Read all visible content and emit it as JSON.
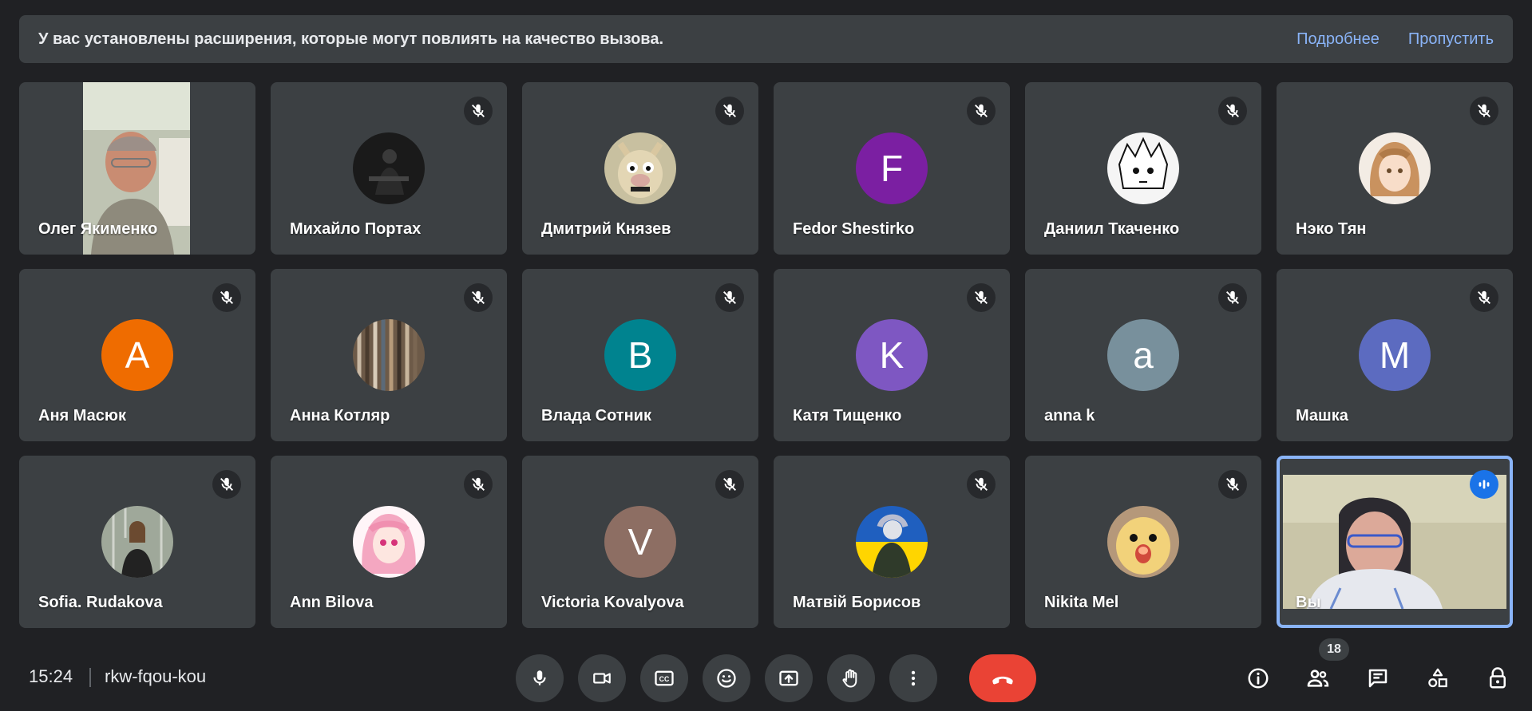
{
  "banner": {
    "message": "У вас установлены расширения, которые могут повлиять на качество вызова.",
    "more_link": "Подробнее",
    "skip_link": "Пропустить"
  },
  "participants": [
    {
      "name": "Олег Якименко",
      "kind": "video",
      "muted": false
    },
    {
      "name": "Михайло Портах",
      "kind": "photo",
      "muted": true
    },
    {
      "name": "Дмитрий Князев",
      "kind": "photo",
      "muted": true
    },
    {
      "name": "Fedor Shestirko",
      "kind": "letter",
      "letter": "F",
      "color": "#7b1fa2",
      "muted": true
    },
    {
      "name": "Даниил Ткаченко",
      "kind": "photo",
      "muted": true
    },
    {
      "name": "Нэко Тян",
      "kind": "photo",
      "muted": true
    },
    {
      "name": "Аня Масюк",
      "kind": "letter",
      "letter": "A",
      "color": "#ef6c00",
      "muted": true
    },
    {
      "name": "Анна Котляр",
      "kind": "photo",
      "muted": true
    },
    {
      "name": "Влада Сотник",
      "kind": "letter",
      "letter": "B",
      "color": "#00838f",
      "muted": true
    },
    {
      "name": "Катя Тищенко",
      "kind": "letter",
      "letter": "K",
      "color": "#7e57c2",
      "muted": true
    },
    {
      "name": "anna k",
      "kind": "letter",
      "letter": "a",
      "color": "#78909c",
      "muted": true
    },
    {
      "name": "Машка",
      "kind": "letter",
      "letter": "M",
      "color": "#5c6bc0",
      "muted": true
    },
    {
      "name": "Sofia. Rudakova",
      "kind": "photo",
      "muted": true
    },
    {
      "name": "Ann Bilova",
      "kind": "photo",
      "muted": true
    },
    {
      "name": "Victoria Kovalyova",
      "kind": "letter",
      "letter": "V",
      "color": "#8d6e63",
      "muted": true
    },
    {
      "name": "Матвій Борисов",
      "kind": "photo",
      "muted": true
    },
    {
      "name": "Nikita Mel",
      "kind": "photo",
      "muted": true
    },
    {
      "name": "Вы",
      "kind": "self",
      "muted": false,
      "speaking": true
    }
  ],
  "bottom_bar": {
    "time": "15:24",
    "meeting_code": "rkw-fqou-kou",
    "participant_count": "18",
    "controls": [
      {
        "name": "microphone-button",
        "icon": "mic-icon"
      },
      {
        "name": "camera-button",
        "icon": "videocam-icon"
      },
      {
        "name": "captions-button",
        "icon": "cc-icon"
      },
      {
        "name": "reactions-button",
        "icon": "emoji-icon"
      },
      {
        "name": "present-button",
        "icon": "present-screen-icon"
      },
      {
        "name": "raise-hand-button",
        "icon": "hand-icon"
      },
      {
        "name": "more-options-button",
        "icon": "more-vert-icon"
      },
      {
        "name": "leave-call-button",
        "icon": "call-end-icon"
      }
    ],
    "right_icons": [
      "info-icon",
      "people-icon",
      "chat-icon",
      "activities-icon",
      "host-controls-icon"
    ]
  },
  "colors": {
    "background": "#202124",
    "tile": "#3c4043",
    "accent": "#8ab4f8",
    "end_call": "#ea4335",
    "speaking": "#1a73e8"
  }
}
